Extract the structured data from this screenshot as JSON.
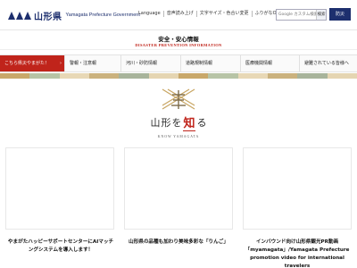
{
  "header": {
    "pref_name": "山形県",
    "pref_name_en": "Yamagata Prefecture Government",
    "utility_links": [
      "Language",
      "音声読み上げ",
      "文字サイズ・色合い変更",
      "ふりがなON"
    ],
    "search": {
      "placeholder": "Google カスタム検索",
      "button_label": "検索"
    },
    "disaster_button": "防災"
  },
  "safety": {
    "title": "安全・安心情報",
    "title_en": "DISASTER PREVENTION INFORMATION"
  },
  "alert_bar": {
    "items": [
      {
        "label": "こちら県災やまがた！"
      },
      {
        "label": "警報・注意報"
      },
      {
        "label": "河川・砂防情報"
      },
      {
        "label": "道路規制情報"
      },
      {
        "label": "医療機関情報"
      },
      {
        "label": "避難されている皆様へ"
      }
    ]
  },
  "know": {
    "title_pre": "山形を",
    "title_key": "知",
    "title_post": "る",
    "title_en": "KNOW YAMAGATA"
  },
  "colors": {
    "brand_navy": "#1d2f6e",
    "accent_red": "#c0241b"
  },
  "cards": [
    {
      "caption_l1": "やまがたハッピーサポートセンターにAIマッチ",
      "caption_l2": "ングシステムを導入します！"
    },
    {
      "caption_l1": "山形県の品種も加わり美味多彩な「りんご」",
      "caption_l2": ""
    },
    {
      "caption_l1": "インバウンド向け山形県観光PR動画",
      "caption_l2": "「myamagata」/Yamagata Prefecture",
      "caption_l3": "promotion video for international travelers"
    }
  ]
}
